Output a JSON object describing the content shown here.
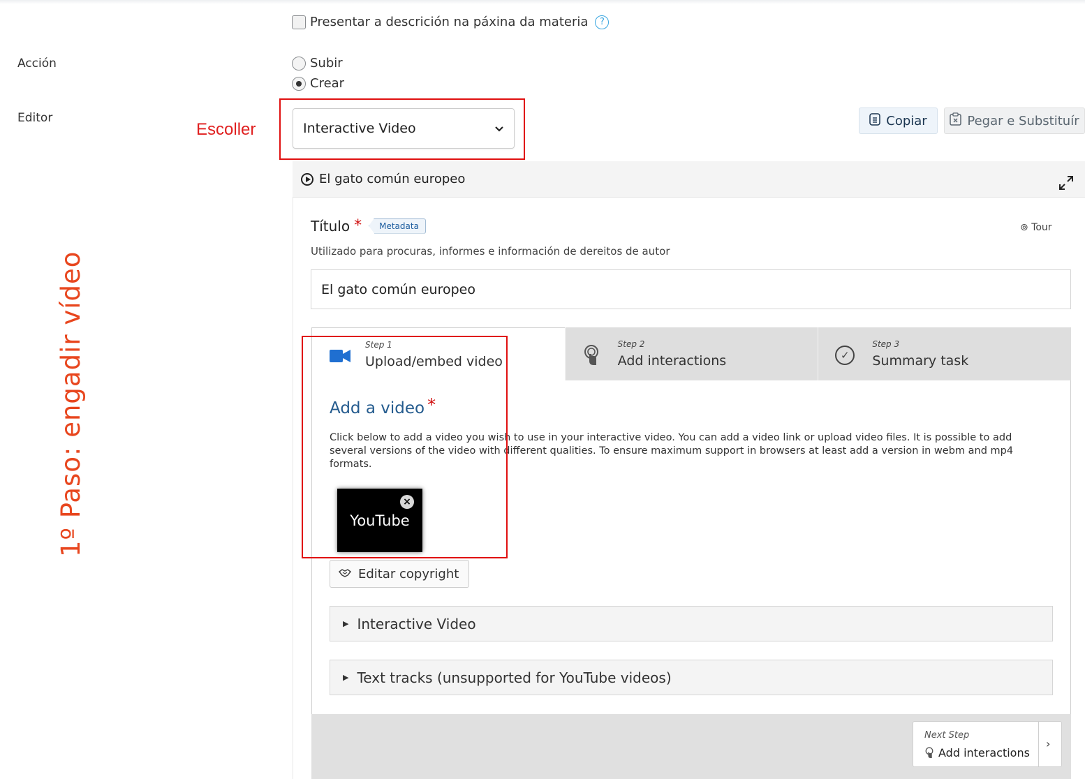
{
  "form": {
    "show_description_label": "Presentar a descrición na páxina da materia",
    "help_glyph": "?",
    "action_label": "Acción",
    "action_options": [
      "Subir",
      "Crear"
    ],
    "action_selected": "Crear",
    "editor_label": "Editor",
    "editor_value": "Interactive Video",
    "copy_label": "Copiar",
    "paste_label": "Pegar e Substituír"
  },
  "annotations": {
    "choose": "Escoller",
    "step_side": "1º Paso: engadir vídeo",
    "highlight_color": "#e01010"
  },
  "h5p": {
    "header_title": "El gato común europeo",
    "title_label": "Título",
    "required_mark": "*",
    "metadata_label": "Metadata",
    "tour_label": "Tour",
    "title_description": "Utilizado para procuras, informes e información de dereitos de autor",
    "title_value": "El gato común europeo",
    "steps": [
      {
        "small": "Step 1",
        "label": "Upload/embed video",
        "icon": "video-camera-icon",
        "active": true
      },
      {
        "small": "Step 2",
        "label": "Add interactions",
        "icon": "touch-bulb-icon",
        "active": false
      },
      {
        "small": "Step 3",
        "label": "Summary task",
        "icon": "check-circle-icon",
        "active": false
      }
    ],
    "add_video_title": "Add a video",
    "add_video_description": "Click below to add a video you wish to use in your interactive video. You can add a video link or upload video files. It is possible to add several versions of the video with different qualities. To ensure maximum support in browsers at least add a version in webm and mp4 formats.",
    "video_thumb_label": "YouTube",
    "edit_copyright_label": "Editar copyright",
    "sections": [
      "Interactive Video",
      "Text tracks (unsupported for YouTube videos)"
    ],
    "next_step_small": "Next Step",
    "next_step_label": "Add interactions",
    "accent_color": "#245b8e",
    "camera_color": "#1f6fd1"
  }
}
